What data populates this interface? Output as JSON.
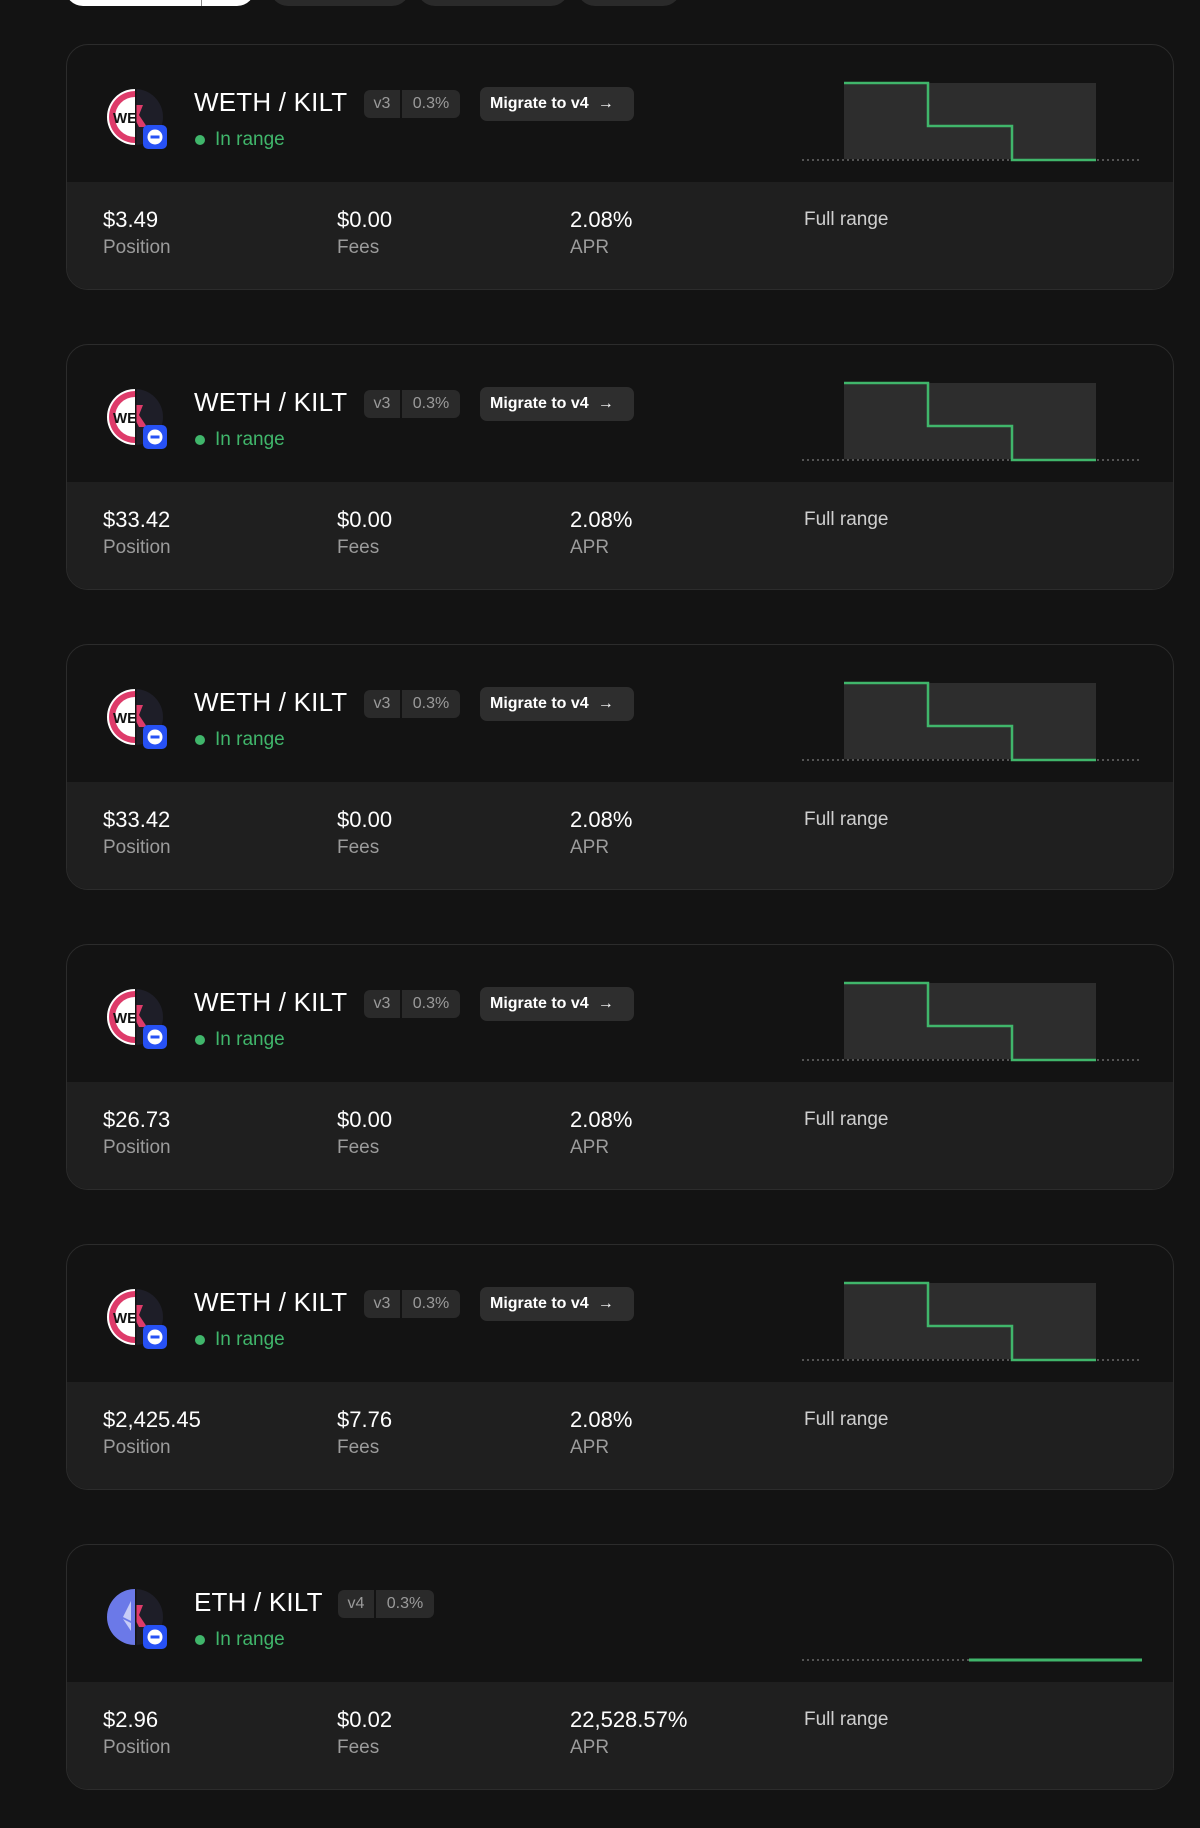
{
  "positions": [
    {
      "pair": "WETH / KILT",
      "version": "v3",
      "fee": "0.3%",
      "migrate_label": "Migrate to v4",
      "status": "In range",
      "position": "$3.49",
      "position_label": "Position",
      "fees": "$0.00",
      "fees_label": "Fees",
      "apr": "2.08%",
      "apr_label": "APR",
      "range": "Full range",
      "token0_icon": "weth-kilt-icon"
    },
    {
      "pair": "WETH / KILT",
      "version": "v3",
      "fee": "0.3%",
      "migrate_label": "Migrate to v4",
      "status": "In range",
      "position": "$33.42",
      "position_label": "Position",
      "fees": "$0.00",
      "fees_label": "Fees",
      "apr": "2.08%",
      "apr_label": "APR",
      "range": "Full range",
      "token0_icon": "weth-kilt-icon"
    },
    {
      "pair": "WETH / KILT",
      "version": "v3",
      "fee": "0.3%",
      "migrate_label": "Migrate to v4",
      "status": "In range",
      "position": "$33.42",
      "position_label": "Position",
      "fees": "$0.00",
      "fees_label": "Fees",
      "apr": "2.08%",
      "apr_label": "APR",
      "range": "Full range",
      "token0_icon": "weth-kilt-icon"
    },
    {
      "pair": "WETH / KILT",
      "version": "v3",
      "fee": "0.3%",
      "migrate_label": "Migrate to v4",
      "status": "In range",
      "position": "$26.73",
      "position_label": "Position",
      "fees": "$0.00",
      "fees_label": "Fees",
      "apr": "2.08%",
      "apr_label": "APR",
      "range": "Full range",
      "token0_icon": "weth-kilt-icon"
    },
    {
      "pair": "WETH / KILT",
      "version": "v3",
      "fee": "0.3%",
      "migrate_label": "Migrate to v4",
      "status": "In range",
      "position": "$2,425.45",
      "position_label": "Position",
      "fees": "$7.76",
      "fees_label": "Fees",
      "apr": "2.08%",
      "apr_label": "APR",
      "range": "Full range",
      "token0_icon": "weth-kilt-icon"
    },
    {
      "pair": "ETH / KILT",
      "version": "v4",
      "fee": "0.3%",
      "migrate_label": "",
      "status": "In range",
      "position": "$2.96",
      "position_label": "Position",
      "fees": "$0.02",
      "fees_label": "Fees",
      "apr": "22,528.57%",
      "apr_label": "APR",
      "range": "Full range",
      "token0_icon": "eth-kilt-icon"
    }
  ],
  "colors": {
    "background": "#131313",
    "card_footer": "#1f1f1f",
    "in_range": "#40b66b",
    "badge": "#2a2a2a",
    "kilt": "#de3b6a",
    "eth": "#6b79e8",
    "network_badge": "#2751f5"
  }
}
